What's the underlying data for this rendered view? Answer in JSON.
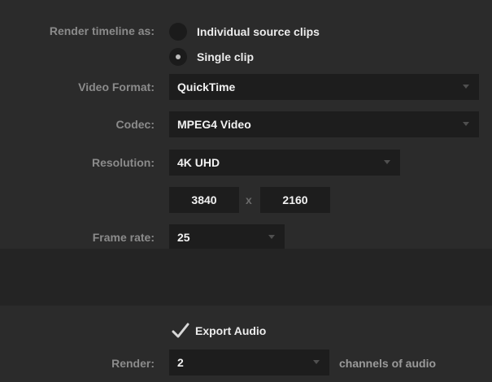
{
  "render_timeline": {
    "label": "Render timeline as:",
    "options": [
      {
        "label": "Individual source clips",
        "selected": false
      },
      {
        "label": "Single clip",
        "selected": true
      }
    ]
  },
  "video_format": {
    "label": "Video Format:",
    "value": "QuickTime"
  },
  "codec": {
    "label": "Codec:",
    "value": "MPEG4 Video"
  },
  "resolution": {
    "label": "Resolution:",
    "value": "4K UHD",
    "width": "3840",
    "separator": "x",
    "height": "2160"
  },
  "frame_rate": {
    "label": "Frame rate:",
    "value": "25"
  },
  "audio": {
    "export_label": "Export Audio",
    "export_checked": true,
    "render_label": "Render:",
    "channels_value": "2",
    "channels_suffix": "channels of audio"
  },
  "colors": {
    "background": "#2b2b2b",
    "field": "#1d1d1d",
    "label": "#8b8b8b",
    "text": "#f2f2f2"
  }
}
